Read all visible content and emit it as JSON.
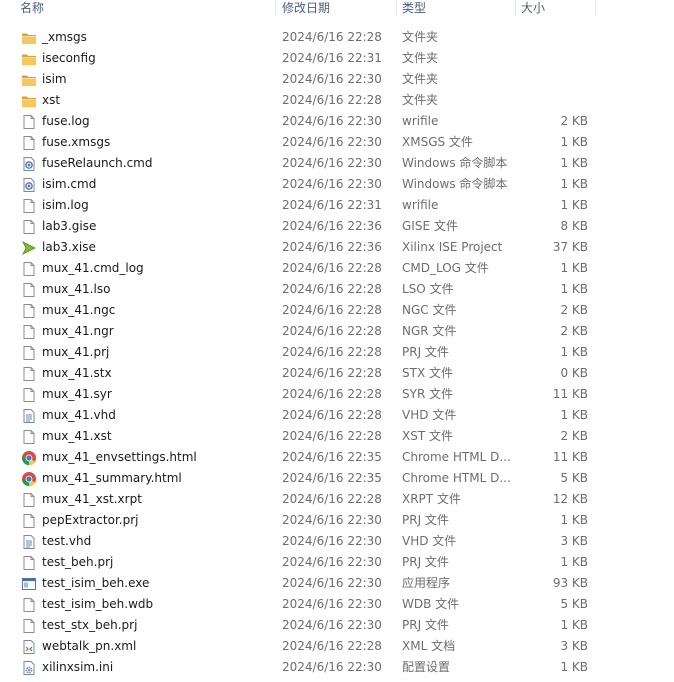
{
  "columns": {
    "name": "名称",
    "date": "修改日期",
    "type": "类型",
    "size": "大小"
  },
  "files": [
    {
      "name": "_xmsgs",
      "date": "2024/6/16 22:28",
      "type": "文件夹",
      "size": "",
      "icon": "folder-icon"
    },
    {
      "name": "iseconfig",
      "date": "2024/6/16 22:31",
      "type": "文件夹",
      "size": "",
      "icon": "folder-icon"
    },
    {
      "name": "isim",
      "date": "2024/6/16 22:30",
      "type": "文件夹",
      "size": "",
      "icon": "folder-icon"
    },
    {
      "name": "xst",
      "date": "2024/6/16 22:28",
      "type": "文件夹",
      "size": "",
      "icon": "folder-icon"
    },
    {
      "name": "fuse.log",
      "date": "2024/6/16 22:30",
      "type": "wrifile",
      "size": "2 KB",
      "icon": "file-icon"
    },
    {
      "name": "fuse.xmsgs",
      "date": "2024/6/16 22:30",
      "type": "XMSGS 文件",
      "size": "1 KB",
      "icon": "file-icon"
    },
    {
      "name": "fuseRelaunch.cmd",
      "date": "2024/6/16 22:30",
      "type": "Windows 命令脚本",
      "size": "1 KB",
      "icon": "cmd-script-icon"
    },
    {
      "name": "isim.cmd",
      "date": "2024/6/16 22:30",
      "type": "Windows 命令脚本",
      "size": "1 KB",
      "icon": "cmd-script-icon"
    },
    {
      "name": "isim.log",
      "date": "2024/6/16 22:31",
      "type": "wrifile",
      "size": "1 KB",
      "icon": "file-icon"
    },
    {
      "name": "lab3.gise",
      "date": "2024/6/16 22:36",
      "type": "GISE 文件",
      "size": "8 KB",
      "icon": "file-icon"
    },
    {
      "name": "lab3.xise",
      "date": "2024/6/16 22:36",
      "type": "Xilinx ISE Project",
      "size": "37 KB",
      "icon": "xilinx-ise-icon"
    },
    {
      "name": "mux_41.cmd_log",
      "date": "2024/6/16 22:28",
      "type": "CMD_LOG 文件",
      "size": "1 KB",
      "icon": "file-icon"
    },
    {
      "name": "mux_41.lso",
      "date": "2024/6/16 22:28",
      "type": "LSO 文件",
      "size": "1 KB",
      "icon": "file-icon"
    },
    {
      "name": "mux_41.ngc",
      "date": "2024/6/16 22:28",
      "type": "NGC 文件",
      "size": "2 KB",
      "icon": "file-icon"
    },
    {
      "name": "mux_41.ngr",
      "date": "2024/6/16 22:28",
      "type": "NGR 文件",
      "size": "2 KB",
      "icon": "file-icon"
    },
    {
      "name": "mux_41.prj",
      "date": "2024/6/16 22:28",
      "type": "PRJ 文件",
      "size": "1 KB",
      "icon": "file-icon"
    },
    {
      "name": "mux_41.stx",
      "date": "2024/6/16 22:28",
      "type": "STX 文件",
      "size": "0 KB",
      "icon": "file-icon"
    },
    {
      "name": "mux_41.syr",
      "date": "2024/6/16 22:28",
      "type": "SYR 文件",
      "size": "11 KB",
      "icon": "file-icon"
    },
    {
      "name": "mux_41.vhd",
      "date": "2024/6/16 22:28",
      "type": "VHD 文件",
      "size": "1 KB",
      "icon": "text-file-icon"
    },
    {
      "name": "mux_41.xst",
      "date": "2024/6/16 22:28",
      "type": "XST 文件",
      "size": "2 KB",
      "icon": "file-icon"
    },
    {
      "name": "mux_41_envsettings.html",
      "date": "2024/6/16 22:35",
      "type": "Chrome HTML D...",
      "size": "11 KB",
      "icon": "chrome-icon"
    },
    {
      "name": "mux_41_summary.html",
      "date": "2024/6/16 22:35",
      "type": "Chrome HTML D...",
      "size": "5 KB",
      "icon": "chrome-icon"
    },
    {
      "name": "mux_41_xst.xrpt",
      "date": "2024/6/16 22:28",
      "type": "XRPT 文件",
      "size": "12 KB",
      "icon": "file-icon"
    },
    {
      "name": "pepExtractor.prj",
      "date": "2024/6/16 22:30",
      "type": "PRJ 文件",
      "size": "1 KB",
      "icon": "file-icon"
    },
    {
      "name": "test.vhd",
      "date": "2024/6/16 22:30",
      "type": "VHD 文件",
      "size": "3 KB",
      "icon": "text-file-icon"
    },
    {
      "name": "test_beh.prj",
      "date": "2024/6/16 22:30",
      "type": "PRJ 文件",
      "size": "1 KB",
      "icon": "file-icon"
    },
    {
      "name": "test_isim_beh.exe",
      "date": "2024/6/16 22:30",
      "type": "应用程序",
      "size": "93 KB",
      "icon": "exe-icon"
    },
    {
      "name": "test_isim_beh.wdb",
      "date": "2024/6/16 22:30",
      "type": "WDB 文件",
      "size": "5 KB",
      "icon": "file-icon"
    },
    {
      "name": "test_stx_beh.prj",
      "date": "2024/6/16 22:30",
      "type": "PRJ 文件",
      "size": "1 KB",
      "icon": "file-icon"
    },
    {
      "name": "webtalk_pn.xml",
      "date": "2024/6/16 22:28",
      "type": "XML 文档",
      "size": "3 KB",
      "icon": "xml-file-icon"
    },
    {
      "name": "xilinxsim.ini",
      "date": "2024/6/16 22:30",
      "type": "配置设置",
      "size": "1 KB",
      "icon": "config-file-icon"
    }
  ]
}
